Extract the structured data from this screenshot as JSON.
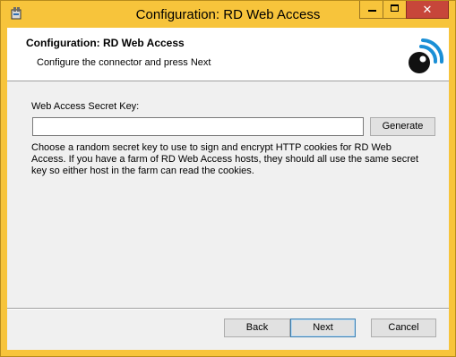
{
  "window": {
    "title": "Configuration: RD Web Access",
    "close_glyph": "✕"
  },
  "header": {
    "title": "Configuration: RD Web Access",
    "subtitle": "Configure the connector and press Next",
    "logo_icon": "wifi-eye-logo-icon"
  },
  "form": {
    "key_label": "Web Access Secret Key:",
    "key_value": "",
    "key_placeholder": "",
    "generate_label": "Generate",
    "description": "Choose a random secret key to use to sign and encrypt HTTP cookies for RD Web Access. If you have a farm of RD Web Access hosts, they should all use the same secret key so either host in the farm can read the cookies."
  },
  "footer": {
    "back_label": "Back",
    "next_label": "Next",
    "cancel_label": "Cancel"
  },
  "colors": {
    "title_bar": "#f7c43b",
    "close_button": "#c7463a",
    "client_background": "#f0f0f0",
    "logo_accent": "#1a8fd6"
  }
}
